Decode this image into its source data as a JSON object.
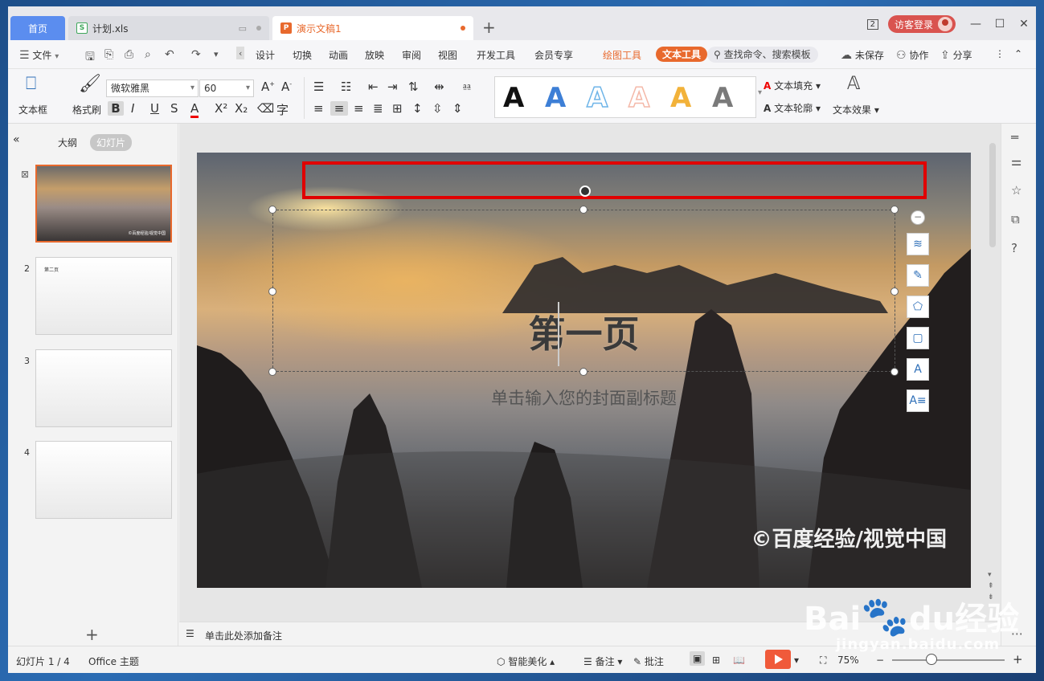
{
  "tabs": {
    "home": "首页",
    "xls": "计划.xls",
    "ppt": "演示文稿1",
    "xls_icon": "S",
    "ppt_icon": "P",
    "add": "+"
  },
  "titlebar": {
    "window_count": "2",
    "login": "访客登录",
    "minimize": "—",
    "maximize": "☐",
    "close": "✕"
  },
  "menu": {
    "file": "文件",
    "items": [
      "设计",
      "切换",
      "动画",
      "放映",
      "审阅",
      "视图",
      "开发工具",
      "会员专享"
    ],
    "drawing_tools": "绘图工具",
    "text_tools": "文本工具",
    "search": "查找命令、搜索模板",
    "unsaved": "未保存",
    "collab": "协作",
    "share": "分享"
  },
  "ribbon": {
    "textbox": "文本框",
    "format_painter": "格式刷",
    "font_name": "微软雅黑",
    "font_size": "60",
    "text_fill": "文本填充",
    "text_outline": "文本轮廓",
    "text_effect": "文本效果",
    "wordart_letter": "A",
    "bold": "B",
    "italic": "I",
    "underline": "U",
    "strike": "S"
  },
  "wordart_colors": [
    "#111111",
    "#3d7fd6",
    "#6fb5e8",
    "#f4b8a8",
    "#f2b23a",
    "#7a7a7a"
  ],
  "left_pane": {
    "collapse": "«",
    "outline_tab": "大纲",
    "slides_tab": "幻灯片",
    "slide_numbers": [
      "2",
      "3",
      "4"
    ],
    "thumb2_title": "第二页",
    "thumb1_watermark": "©百度经验/视觉中国",
    "add": "+"
  },
  "slide": {
    "title": "第一页",
    "subtitle": "单击输入您的封面副标题",
    "watermark": "©百度经验/视觉中国"
  },
  "notes": {
    "placeholder": "单击此处添加备注"
  },
  "status": {
    "slide_count": "幻灯片 1 / 4",
    "theme": "Office 主题",
    "beautify": "智能美化",
    "notes": "备注",
    "comments": "批注",
    "zoom": "75%"
  },
  "watermark": {
    "brand_left": "Bai",
    "brand_mid": "du",
    "brand_cn": "经验",
    "url": "jingyan.baidu.com"
  }
}
